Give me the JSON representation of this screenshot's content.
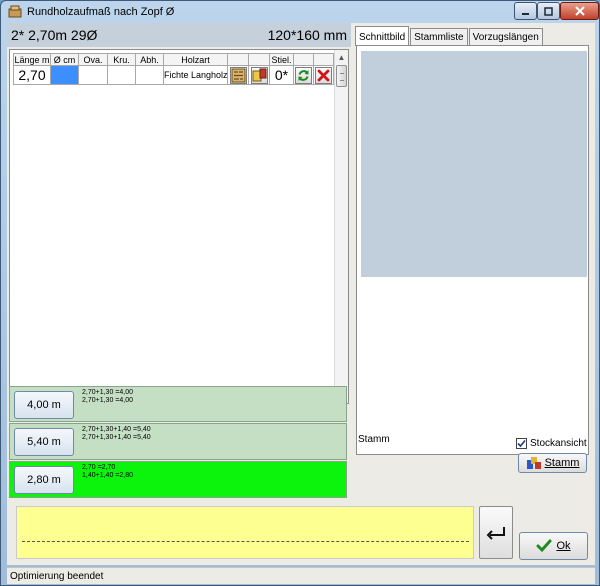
{
  "window": {
    "title": "Rundholzaufmaß nach Zopf Ø"
  },
  "header": {
    "summary": "2* 2,70m 29Ø",
    "dimension": "120*160 mm"
  },
  "grid": {
    "columns": [
      "Länge m",
      "Ø cm",
      "Ova.",
      "Kru.",
      "Abh.",
      "Holzart",
      "",
      "",
      "Stiel.",
      "",
      ""
    ],
    "row": {
      "length": "2,70",
      "diameter": "",
      "ova": "",
      "kru": "",
      "abh": "",
      "holzart": "Fichte Langholz",
      "stiel": "0*"
    }
  },
  "options": [
    {
      "button": "4,00 m",
      "line1": "2,70+1,30 =4,00",
      "line2": "2,70+1,30 =4,00",
      "bg": "#c5dfc5"
    },
    {
      "button": "5,40 m",
      "line1": "2,70+1,30+1,40 =5,40",
      "line2": "2,70+1,30+1,40 =5,40",
      "bg": "#c5dfc5"
    },
    {
      "button": "2,80 m",
      "line1": "2,70 =2,70",
      "line2": "1,40+1,40 =2,80",
      "bg": "#0cf40c"
    }
  ],
  "tabs": [
    "Schnittbild",
    "Stammliste",
    "Vorzugslängen"
  ],
  "right": {
    "stamm_label": "Stamm",
    "stockansicht_label": "Stockansicht",
    "stockansicht_checked": true,
    "stamm_button": "Stamm"
  },
  "bottom": {
    "ok_button": "Ok",
    "status": "Optimierung beendet"
  },
  "colors": {
    "selected_cell": "#3d8eff",
    "note_bg": "#feff91",
    "preview_bg": "#c1cfdc",
    "highlight_row": "#0cf40c"
  },
  "icons": [
    "app-icon",
    "pattern-icon",
    "cut-icon",
    "refresh-icon",
    "delete-icon",
    "enter-icon",
    "check-icon",
    "stamm-icon"
  ]
}
